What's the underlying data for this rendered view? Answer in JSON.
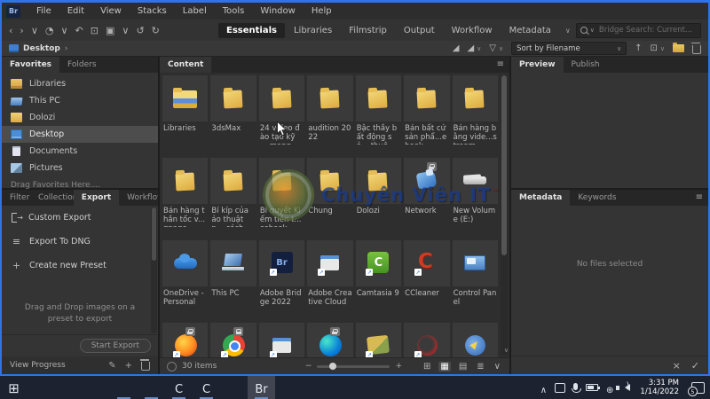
{
  "window": {
    "logo": "Br",
    "menu_items": [
      "File",
      "Edit",
      "View",
      "Stacks",
      "Label",
      "Tools",
      "Window",
      "Help"
    ]
  },
  "toolbar": {
    "nav_icons": [
      {
        "name": "back-icon",
        "glyph": "‹"
      },
      {
        "name": "forward-icon",
        "glyph": "›"
      },
      {
        "name": "recent-files-chevron-icon",
        "glyph": "∨"
      },
      {
        "name": "history-icon",
        "glyph": "◔"
      },
      {
        "name": "history-chevron-icon",
        "glyph": "∨"
      },
      {
        "name": "boomerang-return-icon",
        "glyph": "↶"
      },
      {
        "name": "camera-import-icon",
        "glyph": "⊡"
      },
      {
        "name": "thumbnail-stack-icon",
        "glyph": "▣"
      },
      {
        "name": "stack-chevron-icon",
        "glyph": "∨"
      },
      {
        "name": "refresh-icon",
        "glyph": "↺"
      },
      {
        "name": "rotate-right-icon",
        "glyph": "↻"
      }
    ],
    "workspace_tabs": [
      {
        "label": "Essentials",
        "active": true
      },
      {
        "label": "Libraries"
      },
      {
        "label": "Filmstrip"
      },
      {
        "label": "Output"
      },
      {
        "label": "Workflow"
      },
      {
        "label": "Metadata"
      }
    ],
    "workspace_more_glyph": "∨"
  },
  "search": {
    "placeholder": "Bridge Search: Current..."
  },
  "pathbar": {
    "location": "Desktop",
    "separator": "›",
    "rating_icon_glyph": "◢",
    "rating_chevron_glyph": "∨",
    "filter_icon_glyph": "▽",
    "filter_chevron_glyph": "∨",
    "sort_label": "Sort by Filename",
    "sort_chevron_glyph": "∨",
    "ascending_glyph": "↑",
    "import_glyph": "⊡",
    "import_chevron_glyph": "∨"
  },
  "favorites_panel": {
    "tabs": [
      {
        "label": "Favorites",
        "active": true
      },
      {
        "label": "Folders"
      }
    ],
    "items": [
      {
        "label": "Libraries",
        "icon": "fav-libraries",
        "name": "favorite-libraries"
      },
      {
        "label": "This PC",
        "icon": "fav-thispc",
        "name": "favorite-this-pc"
      },
      {
        "label": "Dolozi",
        "icon": "fav-folder",
        "name": "favorite-dolozi"
      },
      {
        "label": "Desktop",
        "icon": "fav-desktop",
        "name": "favorite-desktop",
        "selected": true
      },
      {
        "label": "Documents",
        "icon": "fav-documents",
        "name": "favorite-documents"
      },
      {
        "label": "Pictures",
        "icon": "fav-pictures",
        "name": "favorite-pictures"
      }
    ],
    "hint": "Drag Favorites Here...."
  },
  "export_panel": {
    "tabs": [
      {
        "label": "Filter"
      },
      {
        "label": "Collections"
      },
      {
        "label": "Export",
        "active": true
      },
      {
        "label": "Workflow"
      }
    ],
    "items": [
      {
        "label": "Custom Export",
        "icon": "exp-custom",
        "name": "custom-export-item"
      },
      {
        "label": "Export To DNG",
        "icon": "exp-dng",
        "name": "export-to-dng-item"
      },
      {
        "label": "Create new Preset",
        "icon": "exp-new",
        "name": "create-new-preset-item"
      }
    ],
    "hint": "Drag and Drop images on a preset to export",
    "start_button": "Start Export",
    "progress_label": "View Progress",
    "edit_glyph": "✎",
    "add_glyph": "+"
  },
  "content_panel": {
    "tab": "Content",
    "menu_glyph": "≡",
    "items": [
      {
        "label": "Libraries",
        "icon": "icon-folder-libraries"
      },
      {
        "label": "3dsMax",
        "icon": "icon-folder"
      },
      {
        "label": "24 video đào tạo kỹ ... mạng",
        "icon": "icon-folder"
      },
      {
        "label": "audition 2022",
        "icon": "icon-folder"
      },
      {
        "label": "Bậc thầy bất động sả... thuê",
        "icon": "icon-folder"
      },
      {
        "label": "Bán bất cứ sản phẩ...ebook",
        "icon": "icon-folder"
      },
      {
        "label": "Bán hàng bằng vide...stream",
        "icon": "icon-folder"
      },
      {
        "label": "Bán hàng thần tốc v...gpage",
        "icon": "icon-folder"
      },
      {
        "label": "Bí kíp của ảo thuật p... cách",
        "icon": "icon-folder"
      },
      {
        "label": "Bí quyết Kiếm tiền t...cebook",
        "icon": "icon-folder"
      },
      {
        "label": "Chung",
        "icon": "icon-folder"
      },
      {
        "label": "Dolozi",
        "icon": "icon-folder"
      },
      {
        "label": "Network",
        "icon": "icon-network",
        "lock": true
      },
      {
        "label": "New Volume (E:)",
        "icon": "icon-drive"
      },
      {
        "label": "OneDrive - Personal",
        "icon": "icon-onedrive"
      },
      {
        "label": "This PC",
        "icon": "icon-thispc"
      },
      {
        "label": "Adobe Bridge 2022",
        "icon": "icon-bridge",
        "shortcut": true
      },
      {
        "label": "Adobe Creative Cloud",
        "icon": "icon-appwindow",
        "shortcut": true
      },
      {
        "label": "Camtasia 9",
        "icon": "icon-camtasia",
        "shortcut": true
      },
      {
        "label": "CCleaner",
        "icon": "icon-ccleaner",
        "shortcut": true
      },
      {
        "label": "Control Panel",
        "icon": "icon-controlpanel"
      },
      {
        "label": "",
        "icon": "icon-firefox",
        "lock": true,
        "shortcut": true
      },
      {
        "label": "",
        "icon": "icon-chrome",
        "lock": true,
        "shortcut": true
      },
      {
        "label": "",
        "icon": "icon-appwindow",
        "shortcut": true
      },
      {
        "label": "",
        "icon": "icon-edge",
        "lock": true
      },
      {
        "label": "",
        "icon": "icon-apputility",
        "shortcut": true
      },
      {
        "label": "",
        "icon": "icon-appdarkred",
        "shortcut": true
      },
      {
        "label": "",
        "icon": "icon-appblue"
      }
    ],
    "status_count": "30 items",
    "zoom_out_glyph": "−",
    "zoom_in_glyph": "+",
    "view_icons": [
      {
        "name": "grid-lock-view-icon",
        "glyph": "⊞"
      },
      {
        "name": "thumbnail-view-icon",
        "glyph": "▦",
        "active": true
      },
      {
        "name": "detail-view-icon",
        "glyph": "▤"
      },
      {
        "name": "list-view-icon",
        "glyph": "≣"
      },
      {
        "name": "view-options-chevron-icon",
        "glyph": "∨"
      }
    ],
    "scroll_down_glyph": "∨"
  },
  "preview_panel": {
    "tabs": [
      {
        "label": "Preview",
        "active": true
      },
      {
        "label": "Publish"
      }
    ]
  },
  "metadata_panel": {
    "tabs": [
      {
        "label": "Metadata",
        "active": true
      },
      {
        "label": "Keywords"
      }
    ],
    "menu_glyph": "≡",
    "empty_text": "No files selected",
    "cancel_glyph": "×",
    "apply_glyph": "✓"
  },
  "watermark": {
    "text": "Chuyên Viên IT",
    "tm": "™"
  },
  "taskbar": {
    "apps": [
      {
        "name": "start-button",
        "icon": "tb-start",
        "glyph": "⊞"
      },
      {
        "name": "taskbar-search-button",
        "icon": "tb-search"
      },
      {
        "name": "cortana-button",
        "icon": "tb-cortana"
      },
      {
        "name": "task-view-button",
        "icon": "tb-taskview"
      },
      {
        "name": "file-explorer-button",
        "icon": "tb-explorer",
        "running": true
      },
      {
        "name": "remote-app-button",
        "icon": "tb-remote",
        "running": true
      },
      {
        "name": "camtasia-button",
        "icon": "tb-camtasia",
        "glyph": "C",
        "running": true
      },
      {
        "name": "ccleaner-button",
        "icon": "tb-ccleaner",
        "glyph": "C",
        "running": true
      },
      {
        "name": "defender-button",
        "icon": "tb-defender"
      },
      {
        "name": "adobe-bridge-button",
        "icon": "tb-bridge",
        "glyph": "Br",
        "active": true,
        "running": true
      }
    ],
    "tray": [
      {
        "name": "hidden-icons-chevron-icon",
        "icon": "tray-text",
        "glyph": "∧"
      },
      {
        "name": "onedrive-tray-icon",
        "icon": "tray-box"
      },
      {
        "name": "microphone-tray-icon",
        "icon": "tray-mic"
      },
      {
        "name": "battery-tray-icon",
        "icon": "tray-battery"
      },
      {
        "name": "network-globe-tray-icon",
        "icon": "tray-text",
        "glyph": "⊕"
      },
      {
        "name": "volume-tray-icon",
        "icon": "tray-vol"
      }
    ],
    "clock": {
      "time": "3:31 PM",
      "date": "1/14/2022"
    },
    "notification_badge": "5"
  }
}
